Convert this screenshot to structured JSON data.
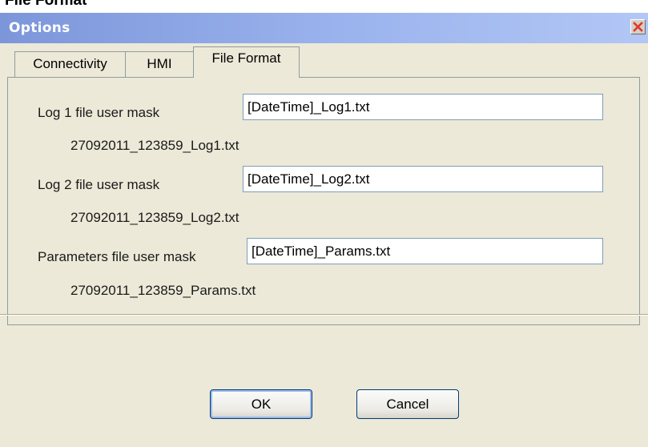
{
  "page_heading": "File Format",
  "window": {
    "title": "Options",
    "close_symbol": "×"
  },
  "tabs": [
    {
      "label": "Connectivity",
      "selected": false
    },
    {
      "label": "HMI",
      "selected": false
    },
    {
      "label": "File Format",
      "selected": true
    }
  ],
  "fields": [
    {
      "label": "Log 1 file user mask",
      "value": "[DateTime]_Log1.txt",
      "preview": "27092011_123859_Log1.txt"
    },
    {
      "label": "Log 2 file user mask",
      "value": "[DateTime]_Log2.txt",
      "preview": "27092011_123859_Log2.txt"
    },
    {
      "label": "Parameters file user mask",
      "value": "[DateTime]_Params.txt",
      "preview": "27092011_123859_Params.txt"
    }
  ],
  "buttons": {
    "ok": "OK",
    "cancel": "Cancel"
  },
  "icons": {
    "close": "close-icon"
  },
  "colors": {
    "dialog_background": "#ece9d8",
    "titlebar_start": "#7c96da",
    "titlebar_end": "#b2c7f5",
    "input_border": "#7f9db9",
    "close_x": "#e0392a"
  }
}
